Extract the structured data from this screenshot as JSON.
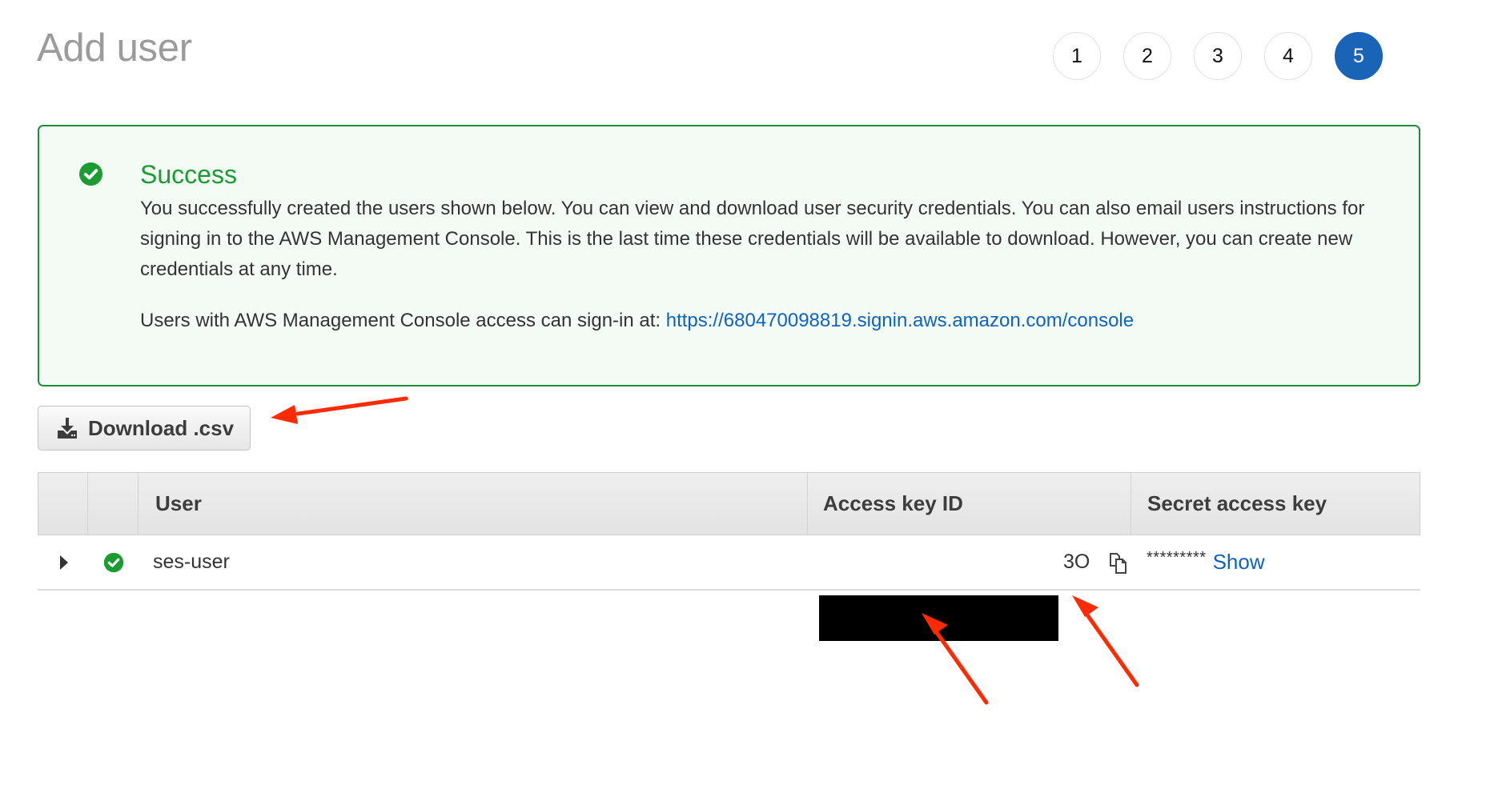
{
  "page": {
    "title": "Add user"
  },
  "steps": [
    {
      "label": "1",
      "active": false
    },
    {
      "label": "2",
      "active": false
    },
    {
      "label": "3",
      "active": false
    },
    {
      "label": "4",
      "active": false
    },
    {
      "label": "5",
      "active": true
    }
  ],
  "alert": {
    "type": "success",
    "icon": "check-circle-icon",
    "title": "Success",
    "body": "You successfully created the users shown below. You can view and download user security credentials. You can also email users instructions for signing in to the AWS Management Console. This is the last time these credentials will be available to download. However, you can create new credentials at any time.",
    "signin_prefix": "Users with AWS Management Console access can sign-in at: ",
    "signin_url": "https://680470098819.signin.aws.amazon.com/console"
  },
  "actions": {
    "download_label": "Download .csv",
    "download_icon": "download-icon"
  },
  "table": {
    "columns": [
      "",
      "",
      "User",
      "Access key ID",
      "Secret access key"
    ],
    "rows": [
      {
        "status_icon": "check-circle-icon",
        "user": "ses-user",
        "access_key_id_visible_suffix": "3O",
        "access_key_id_redacted": true,
        "secret_access_key_mask": "*********",
        "show_label": "Show"
      }
    ]
  },
  "colors": {
    "success_green": "#1d8f38",
    "success_bg": "#f4fbf5",
    "link_blue": "#0d63c4",
    "active_step": "#1a64b8",
    "annotation_red": "#ff2a00"
  },
  "annotations": {
    "arrows": 3
  }
}
